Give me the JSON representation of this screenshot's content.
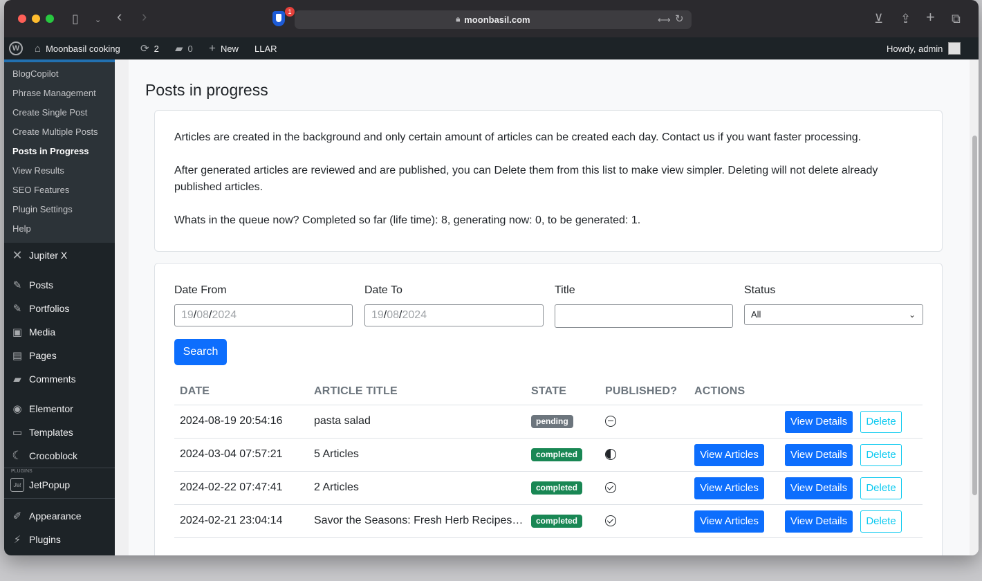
{
  "browser": {
    "url": "moonbasil.com",
    "extension_badge": "1"
  },
  "adminbar": {
    "site_name": "Moonbasil cooking",
    "updates_count": "2",
    "comments_count": "0",
    "new_label": "New",
    "llar_label": "LLAR",
    "greeting": "Howdy, admin"
  },
  "sidebar": {
    "submenu": [
      {
        "label": "BlogCopilot"
      },
      {
        "label": "Phrase Management"
      },
      {
        "label": "Create Single Post"
      },
      {
        "label": "Create Multiple Posts"
      },
      {
        "label": "Posts in Progress"
      },
      {
        "label": "View Results"
      },
      {
        "label": "SEO Features"
      },
      {
        "label": "Plugin Settings"
      },
      {
        "label": "Help"
      }
    ],
    "menu": {
      "jupiter": "Jupiter X",
      "posts": "Posts",
      "portfolios": "Portfolios",
      "media": "Media",
      "pages": "Pages",
      "comments": "Comments",
      "elementor": "Elementor",
      "templates": "Templates",
      "crocoblock": "Crocoblock",
      "plugins_section": "PLUGINS",
      "jetpopup": "JetPopup",
      "appearance": "Appearance",
      "plugins": "Plugins"
    }
  },
  "page": {
    "title": "Posts in progress",
    "info": [
      "Articles are created in the background and only certain amount of articles can be created each day. Contact us if you want faster processing.",
      "After generated articles are reviewed and are published, you can Delete them from this list to make view simpler. Deleting will not delete already published articles.",
      "Whats in the queue now? Completed so far (life time): 8, generating now: 0, to be generated: 1."
    ]
  },
  "filters": {
    "date_from_label": "Date From",
    "date_to_label": "Date To",
    "title_label": "Title",
    "status_label": "Status",
    "date_from": {
      "d": "19",
      "m": "08",
      "y": "2024"
    },
    "date_to": {
      "d": "19",
      "m": "08",
      "y": "2024"
    },
    "title_value": "",
    "status_value": "All",
    "search_label": "Search"
  },
  "table": {
    "headers": {
      "date": "DATE",
      "title": "ARTICLE TITLE",
      "state": "STATE",
      "published": "PUBLISHED?",
      "actions": "ACTIONS"
    },
    "buttons": {
      "view_articles": "View Articles",
      "view_details": "View Details",
      "delete": "Delete"
    },
    "rows": [
      {
        "date": "2024-08-19 20:54:16",
        "title": "pasta salad",
        "state": "pending",
        "published": "none"
      },
      {
        "date": "2024-03-04 07:57:21",
        "title": "5 Articles",
        "state": "completed",
        "published": "partial"
      },
      {
        "date": "2024-02-22 07:47:41",
        "title": "2 Articles",
        "state": "completed",
        "published": "all"
      },
      {
        "date": "2024-02-21 23:04:14",
        "title": "Savor the Seasons: Fresh Herb Recipes…",
        "state": "completed",
        "published": "all"
      }
    ]
  },
  "colors": {
    "primary": "#0d6efd",
    "info_outline": "#0dcaf0",
    "pending": "#6c757d",
    "completed": "#198754",
    "wp_dark": "#1d2327",
    "wp_accent": "#2271b1"
  }
}
